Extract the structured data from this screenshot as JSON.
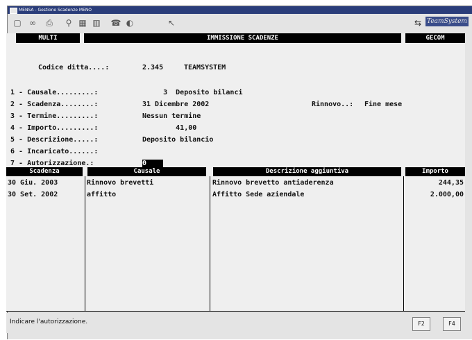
{
  "window": {
    "title": "MENSA - Gestione Scadenze MENO"
  },
  "toolbar": {
    "icons": [
      "window-icon",
      "glasses-icon",
      "print-icon",
      "filter-icon",
      "calculator-icon",
      "table-icon",
      "phone-icon",
      "help-icon",
      "pointer-icon"
    ],
    "glyphs": [
      "▢",
      "∞",
      "⎙",
      "⚲",
      "▦",
      "▥",
      "☎",
      "◐",
      "↖"
    ],
    "right_icon": "⇆",
    "right_label": "TeamSystem"
  },
  "header": {
    "left": "MULTI",
    "center": "IMMISSIONE  SCADENZE",
    "right": "GECOM"
  },
  "company": {
    "label": "Codice ditta....:",
    "code": "2.345",
    "name": "TEAMSYSTEM"
  },
  "fields": [
    {
      "label": "1 - Causale.........:",
      "value": "     3  Deposito bilanci"
    },
    {
      "label": "2 - Scadenza........:",
      "value": "31 Dicembre 2002"
    },
    {
      "label": "3 - Termine.........:",
      "value": "Nessun termine"
    },
    {
      "label": "4 - Importo.........:",
      "value": "        41,00"
    },
    {
      "label": "5 - Descrizione.....:",
      "value": "Deposito bilancio"
    },
    {
      "label": "6 - Incaricato......:",
      "value": ""
    },
    {
      "label": "7 - Autorizzazione.:",
      "value": "0"
    }
  ],
  "rinnovo": {
    "label": "Rinnovo..:",
    "value": "Fine mese"
  },
  "table": {
    "headers": [
      "Scadenza",
      "Causale",
      "Descrizione aggiuntiva",
      "Importo"
    ],
    "rows": [
      [
        "30 Giu. 2003",
        "Rinnovo brevetti",
        "Rinnovo brevetto antiaderenza",
        "244,35"
      ],
      [
        "30 Set. 2002",
        "affitto",
        "Affitto Sede aziendale",
        "2.000,00"
      ]
    ]
  },
  "status": {
    "message": "Indicare l'autorizzazione.",
    "f2": "F2",
    "f4": "F4"
  }
}
